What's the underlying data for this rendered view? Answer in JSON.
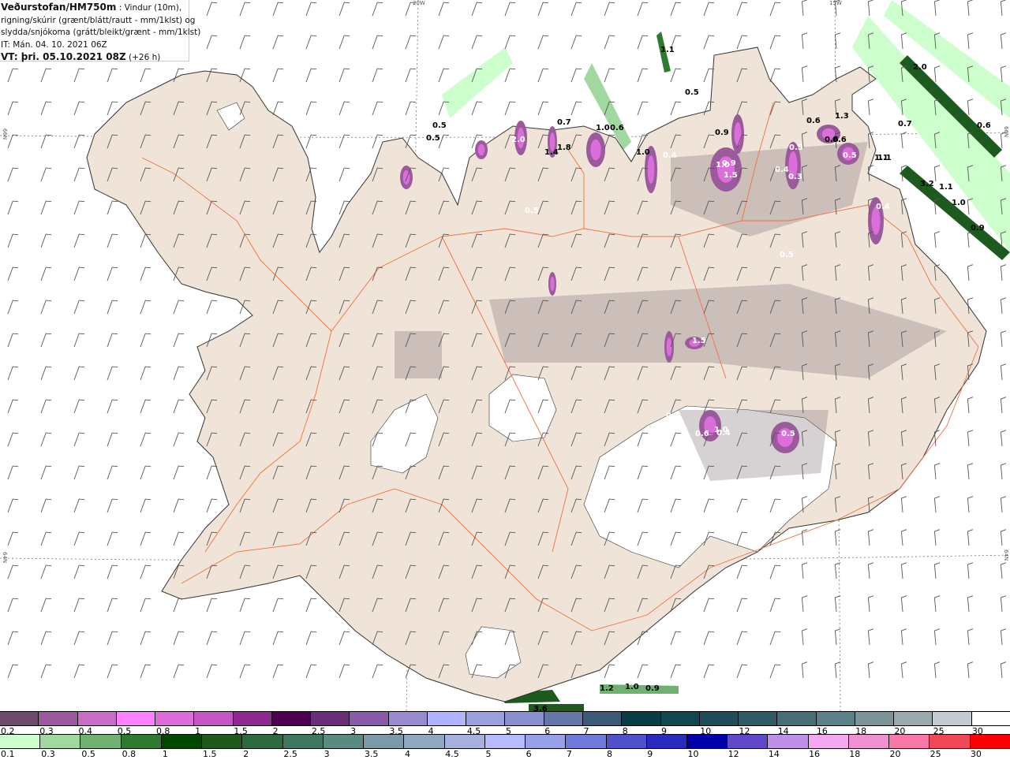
{
  "header": {
    "source": "Veðurstofan/HM750m",
    "description_1": " : Vindur (10m),",
    "description_2": "rigning/skúrir (grænt/blátt/rautt - mm/1klst) og",
    "description_3": "slydda/snjókoma (grátt/bleikt/grænt - mm/1klst)",
    "issue_time": "IT: Mán. 04. 10. 2021 06Z",
    "valid_label": "VT: þri. 05.10.2021 08Z",
    "valid_offset": " (+26 h)"
  },
  "grid_labels": {
    "lon_20w": "20W",
    "lon_15w": "15W",
    "lat_66n_left": "66N",
    "lat_66n_right": "66N",
    "lat_64n_left": "64N",
    "lat_64n_right": "64N"
  },
  "colors": {
    "land": "#f0e4d8",
    "roads": "#f07040",
    "sea": "#ffffff",
    "glacier": "#ffffff",
    "coast": "#333333",
    "wind_barb": "#555555"
  },
  "precip_labels_rain": [
    "0.5",
    "0.5",
    "1.1",
    "0.5",
    "2.0",
    "0.7",
    "0.6",
    "0.7",
    "0.6",
    "3.2",
    "1.1",
    "1.0",
    "0.9",
    "1.3",
    "1.1",
    "1.2",
    "1.0",
    "0.9",
    "3.6",
    "1.4",
    "1.8",
    "1.0",
    "0.6",
    "0.9",
    "1.0",
    "0.6",
    "0.6",
    "1.1"
  ],
  "precip_labels_snow": [
    "2.0",
    "0.9",
    "1.5",
    "1.0",
    "0.5",
    "0.3",
    "0.4",
    "0.5",
    "0.6",
    "1.5",
    "1.0",
    "0.4",
    "0.6",
    "0.5",
    "0.5",
    "0.4",
    "0.5",
    "0.4"
  ],
  "legend_snow": {
    "labels": [
      "0.2",
      "0.3",
      "0.4",
      "0.5",
      "0.8",
      "1",
      "1.5",
      "2",
      "2.5",
      "3",
      "3.5",
      "4",
      "4.5",
      "5",
      "6",
      "7",
      "8",
      "9",
      "10",
      "12",
      "14",
      "16",
      "18",
      "20",
      "25",
      "30"
    ],
    "colors": [
      "#6b4a6b",
      "#9b5a9b",
      "#c86ec8",
      "#ff80ff",
      "#dc6edc",
      "#c356c3",
      "#912891",
      "#500050",
      "#6a2d7a",
      "#8a5aaa",
      "#9a8ad2",
      "#b0b4ff",
      "#98a0e0",
      "#8890d0",
      "#6478a8",
      "#3c5a78",
      "#0a3c46",
      "#14464f",
      "#1e4e5a",
      "#2e5c64",
      "#466e76",
      "#5a8088",
      "#7a9498",
      "#98aaae",
      "#c4ccd0",
      "#ffffff"
    ]
  },
  "legend_rain": {
    "labels": [
      "0.1",
      "0.3",
      "0.5",
      "0.8",
      "1",
      "1.5",
      "2",
      "2.5",
      "3",
      "3.5",
      "4",
      "4.5",
      "5",
      "6",
      "7",
      "8",
      "9",
      "10",
      "12",
      "14",
      "16",
      "18",
      "20",
      "25",
      "30"
    ],
    "colors": [
      "#ccffcc",
      "#a0d8a0",
      "#70b070",
      "#2e7a2e",
      "#004800",
      "#1e5a1e",
      "#2e6a40",
      "#3e7860",
      "#5a8a80",
      "#7a9aa8",
      "#90a8c0",
      "#a8b0e0",
      "#b8bcff",
      "#98a0ea",
      "#7078da",
      "#5050cc",
      "#2a2abe",
      "#0000a8",
      "#6048c8",
      "#c090e8",
      "#f4a8f0",
      "#f090d0",
      "#f878a8",
      "#f04858",
      "#ff0000"
    ]
  }
}
